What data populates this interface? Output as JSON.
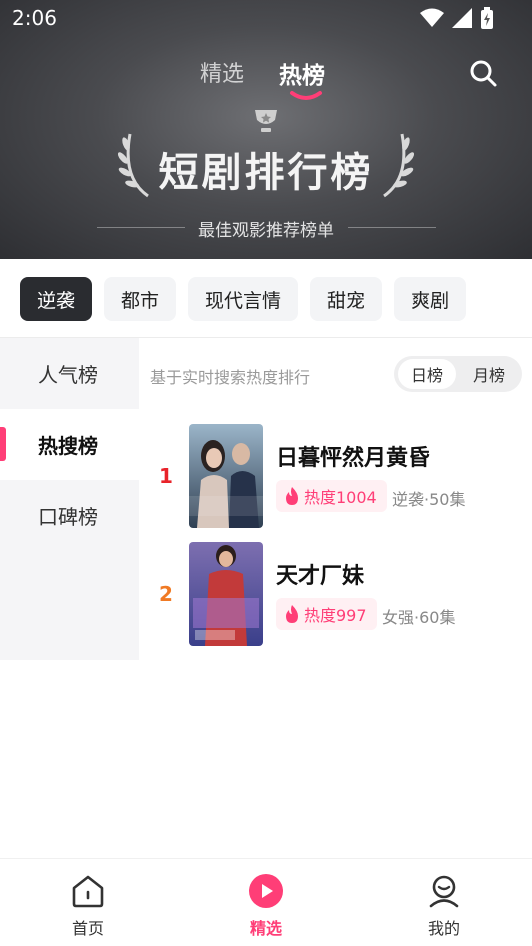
{
  "status_bar": {
    "time": "2:06",
    "icons": [
      "wifi-icon",
      "signal-icon",
      "battery-icon"
    ]
  },
  "header": {
    "tabs": [
      {
        "label": "精选",
        "active": false
      },
      {
        "label": "热榜",
        "active": true
      }
    ],
    "banner_title": "短剧排行榜",
    "banner_subtitle": "最佳观影推荐榜单"
  },
  "genres": [
    {
      "label": "逆袭",
      "active": true
    },
    {
      "label": "都市",
      "active": false
    },
    {
      "label": "现代言情",
      "active": false
    },
    {
      "label": "甜宠",
      "active": false
    },
    {
      "label": "爽剧",
      "active": false
    }
  ],
  "side_nav": [
    {
      "label": "人气榜",
      "active": false
    },
    {
      "label": "热搜榜",
      "active": true
    },
    {
      "label": "口碑榜",
      "active": false
    }
  ],
  "list": {
    "description": "基于实时搜索热度排行",
    "period_toggle": [
      {
        "label": "日榜",
        "active": true
      },
      {
        "label": "月榜",
        "active": false
      }
    ],
    "items": [
      {
        "rank": "1",
        "title": "日暮怦然月黄昏",
        "heat": "热度1004",
        "meta": "逆袭·50集"
      },
      {
        "rank": "2",
        "title": "天才厂妹",
        "heat": "热度997",
        "meta": "女强·60集"
      }
    ]
  },
  "bottom_nav": [
    {
      "label": "首页",
      "icon": "home-icon",
      "active": false
    },
    {
      "label": "精选",
      "icon": "play-icon",
      "active": true
    },
    {
      "label": "我的",
      "icon": "profile-icon",
      "active": false
    }
  ],
  "colors": {
    "accent": "#ff3e77",
    "rank1": "#e8232a",
    "rank2": "#f07a24",
    "chip_active": "#2a2c30"
  }
}
